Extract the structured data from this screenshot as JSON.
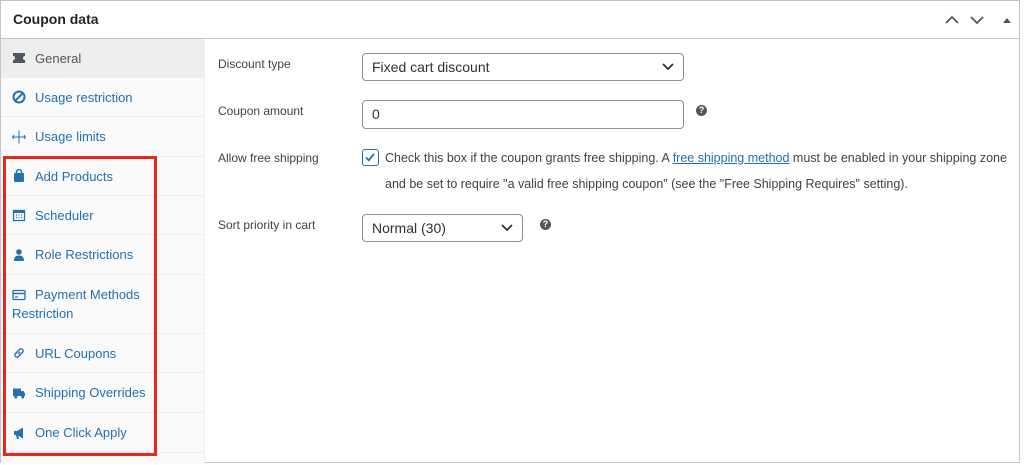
{
  "panel": {
    "title": "Coupon data"
  },
  "tabs": [
    {
      "label": "General",
      "icon": "ticket-icon",
      "active": true
    },
    {
      "label": "Usage restriction",
      "icon": "block-icon"
    },
    {
      "label": "Usage limits",
      "icon": "limits-icon"
    },
    {
      "label": "Add Products",
      "icon": "bag-icon"
    },
    {
      "label": "Scheduler",
      "icon": "calendar-icon"
    },
    {
      "label": "Role Restrictions",
      "icon": "person-icon"
    },
    {
      "label": "Payment Methods Restriction",
      "icon": "card-icon"
    },
    {
      "label": "URL Coupons",
      "icon": "link-icon"
    },
    {
      "label": "Shipping Overrides",
      "icon": "truck-icon"
    },
    {
      "label": "One Click Apply",
      "icon": "megaphone-icon"
    }
  ],
  "fields": {
    "discount_type": {
      "label": "Discount type",
      "value": "Fixed cart discount"
    },
    "coupon_amount": {
      "label": "Coupon amount",
      "value": "0"
    },
    "free_shipping": {
      "label": "Allow free shipping",
      "checked": true,
      "text_before": "Check this box if the coupon grants free shipping. A ",
      "link_text": "free shipping method",
      "text_after": " must be enabled in your shipping zone and be set to require \"a valid free shipping coupon\" (see the \"Free Shipping Requires\" setting)."
    },
    "sort_priority": {
      "label": "Sort priority in cart",
      "value": "Normal (30)"
    }
  },
  "help_glyph": "?",
  "colors": {
    "link": "#2271b1",
    "highlight": "#e8271b",
    "border": "#c3c4c7"
  }
}
